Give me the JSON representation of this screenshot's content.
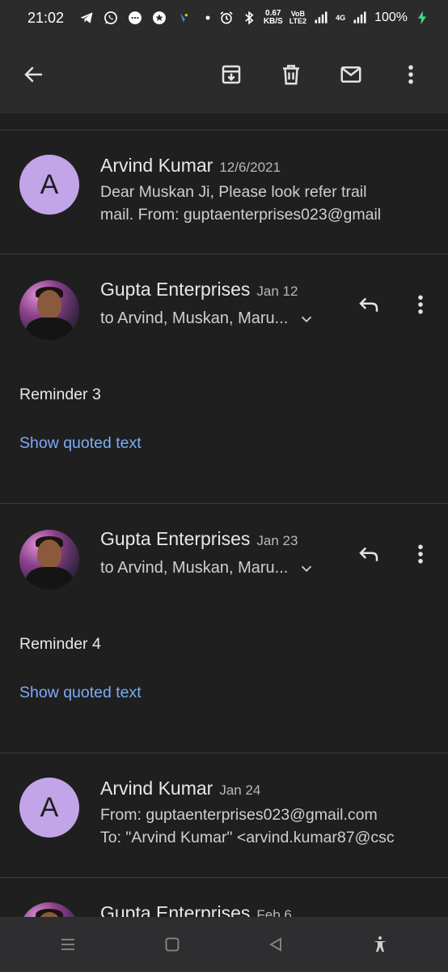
{
  "status_bar": {
    "time": "21:02",
    "net_speed_value": "0.67",
    "net_speed_unit": "KB/S",
    "volte_top": "VoB",
    "volte_bottom": "LTE2",
    "network_type": "4G",
    "battery": "100%",
    "icons": [
      "telegram-icon",
      "whatsapp-icon",
      "chat-bubble-icon",
      "star-badge-icon",
      "shield-app-icon",
      "dot-icon",
      "alarm-icon",
      "bluetooth-icon",
      "signal-icon",
      "battery-charging-icon"
    ]
  },
  "app_bar": {
    "icons": [
      "back-arrow-icon",
      "archive-icon",
      "trash-icon",
      "mail-icon",
      "more-vert-icon"
    ]
  },
  "messages": [
    {
      "sender": "Arvind Kumar",
      "date": "12/6/2021",
      "avatar_letter": "A",
      "snippet_line1": "Dear Muskan Ji, Please look refer trail",
      "snippet_line2": "mail. From: guptaenterprises023@gmail"
    },
    {
      "sender": "Gupta Enterprises",
      "date": "Jan 12",
      "to": "to Arvind, Muskan, Maru...",
      "body": "Reminder 3",
      "quoted": "Show quoted text"
    },
    {
      "sender": "Gupta Enterprises",
      "date": "Jan 23",
      "to": "to Arvind, Muskan, Maru...",
      "body": "Reminder 4",
      "quoted": "Show quoted text"
    },
    {
      "sender": "Arvind Kumar",
      "date": "Jan 24",
      "avatar_letter": "A",
      "snippet_line1": "From: guptaenterprises023@gmail.com",
      "snippet_line2": "To: \"Arvind Kumar\" <arvind.kumar87@csc"
    },
    {
      "sender": "Gupta Enterprises",
      "date": "Feb 6"
    }
  ],
  "colors": {
    "background": "#1f1f1f",
    "app_bar": "#2b2b2b",
    "avatar_letter_bg": "#c2a4e8",
    "link": "#7cacf8",
    "divider": "#3c3c3c"
  },
  "nav_bar": {
    "icons": [
      "recents-icon",
      "home-icon",
      "back-triangle-icon",
      "accessibility-icon"
    ]
  }
}
